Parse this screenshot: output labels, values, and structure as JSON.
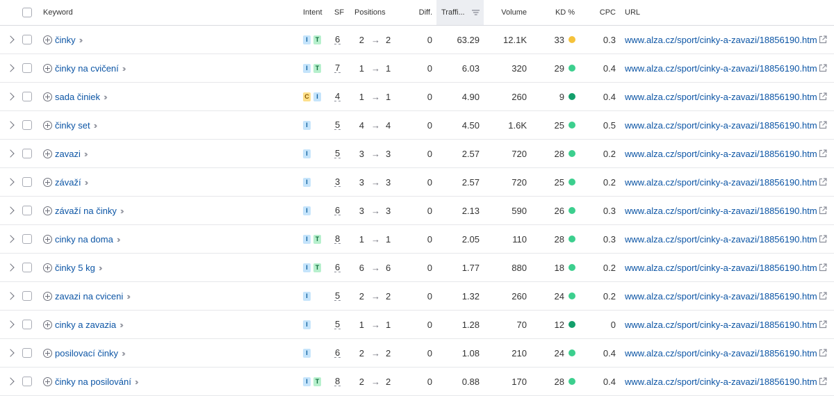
{
  "header": {
    "keyword": "Keyword",
    "intent": "Intent",
    "sf": "SF",
    "positions": "Positions",
    "diff": "Diff.",
    "traffic": "Traffi...",
    "volume": "Volume",
    "kd": "KD %",
    "cpc": "CPC",
    "url": "URL"
  },
  "kd_colors": {
    "easy": "#3ccf8e",
    "medium": "#f5c23b",
    "very_easy": "#129f6b"
  },
  "rows": [
    {
      "keyword": "činky",
      "intent": [
        "I",
        "T"
      ],
      "sf": "6",
      "pos_from": "2",
      "pos_to": "2",
      "diff": "0",
      "traffic": "63.29",
      "volume": "12.1K",
      "kd": "33",
      "kd_color": "#f5c23b",
      "cpc": "0.3",
      "url": "www.alza.cz/sport/cinky-a-zavazi/18856190.htm"
    },
    {
      "keyword": "činky na cvičení",
      "intent": [
        "I",
        "T"
      ],
      "sf": "7",
      "pos_from": "1",
      "pos_to": "1",
      "diff": "0",
      "traffic": "6.03",
      "volume": "320",
      "kd": "29",
      "kd_color": "#3ccf8e",
      "cpc": "0.4",
      "url": "www.alza.cz/sport/cinky-a-zavazi/18856190.htm"
    },
    {
      "keyword": "sada činiek",
      "intent": [
        "C",
        "I"
      ],
      "sf": "4",
      "pos_from": "1",
      "pos_to": "1",
      "diff": "0",
      "traffic": "4.90",
      "volume": "260",
      "kd": "9",
      "kd_color": "#129f6b",
      "cpc": "0.4",
      "url": "www.alza.cz/sport/cinky-a-zavazi/18856190.htm"
    },
    {
      "keyword": "činky set",
      "intent": [
        "I"
      ],
      "sf": "5",
      "pos_from": "4",
      "pos_to": "4",
      "diff": "0",
      "traffic": "4.50",
      "volume": "1.6K",
      "kd": "25",
      "kd_color": "#3ccf8e",
      "cpc": "0.5",
      "url": "www.alza.cz/sport/cinky-a-zavazi/18856190.htm"
    },
    {
      "keyword": "zavazi",
      "intent": [
        "I"
      ],
      "sf": "5",
      "pos_from": "3",
      "pos_to": "3",
      "diff": "0",
      "traffic": "2.57",
      "volume": "720",
      "kd": "28",
      "kd_color": "#3ccf8e",
      "cpc": "0.2",
      "url": "www.alza.cz/sport/cinky-a-zavazi/18856190.htm"
    },
    {
      "keyword": "závaží",
      "intent": [
        "I"
      ],
      "sf": "3",
      "pos_from": "3",
      "pos_to": "3",
      "diff": "0",
      "traffic": "2.57",
      "volume": "720",
      "kd": "25",
      "kd_color": "#3ccf8e",
      "cpc": "0.2",
      "url": "www.alza.cz/sport/cinky-a-zavazi/18856190.htm"
    },
    {
      "keyword": "závaží na činky",
      "intent": [
        "I"
      ],
      "sf": "6",
      "pos_from": "3",
      "pos_to": "3",
      "diff": "0",
      "traffic": "2.13",
      "volume": "590",
      "kd": "26",
      "kd_color": "#3ccf8e",
      "cpc": "0.3",
      "url": "www.alza.cz/sport/cinky-a-zavazi/18856190.htm"
    },
    {
      "keyword": "cinky na doma",
      "intent": [
        "I",
        "T"
      ],
      "sf": "8",
      "pos_from": "1",
      "pos_to": "1",
      "diff": "0",
      "traffic": "2.05",
      "volume": "110",
      "kd": "28",
      "kd_color": "#3ccf8e",
      "cpc": "0.3",
      "url": "www.alza.cz/sport/cinky-a-zavazi/18856190.htm"
    },
    {
      "keyword": "činky 5 kg",
      "intent": [
        "I",
        "T"
      ],
      "sf": "6",
      "pos_from": "6",
      "pos_to": "6",
      "diff": "0",
      "traffic": "1.77",
      "volume": "880",
      "kd": "18",
      "kd_color": "#3ccf8e",
      "cpc": "0.2",
      "url": "www.alza.cz/sport/cinky-a-zavazi/18856190.htm"
    },
    {
      "keyword": "zavazi na cviceni",
      "intent": [
        "I"
      ],
      "sf": "5",
      "pos_from": "2",
      "pos_to": "2",
      "diff": "0",
      "traffic": "1.32",
      "volume": "260",
      "kd": "24",
      "kd_color": "#3ccf8e",
      "cpc": "0.2",
      "url": "www.alza.cz/sport/cinky-a-zavazi/18856190.htm"
    },
    {
      "keyword": "cinky a zavazia",
      "intent": [
        "I"
      ],
      "sf": "5",
      "pos_from": "1",
      "pos_to": "1",
      "diff": "0",
      "traffic": "1.28",
      "volume": "70",
      "kd": "12",
      "kd_color": "#129f6b",
      "cpc": "0",
      "url": "www.alza.cz/sport/cinky-a-zavazi/18856190.htm"
    },
    {
      "keyword": "posilovací činky",
      "intent": [
        "I"
      ],
      "sf": "6",
      "pos_from": "2",
      "pos_to": "2",
      "diff": "0",
      "traffic": "1.08",
      "volume": "210",
      "kd": "24",
      "kd_color": "#3ccf8e",
      "cpc": "0.4",
      "url": "www.alza.cz/sport/cinky-a-zavazi/18856190.htm"
    },
    {
      "keyword": "činky na posilování",
      "intent": [
        "I",
        "T"
      ],
      "sf": "8",
      "pos_from": "2",
      "pos_to": "2",
      "diff": "0",
      "traffic": "0.88",
      "volume": "170",
      "kd": "28",
      "kd_color": "#3ccf8e",
      "cpc": "0.4",
      "url": "www.alza.cz/sport/cinky-a-zavazi/18856190.htm"
    }
  ]
}
